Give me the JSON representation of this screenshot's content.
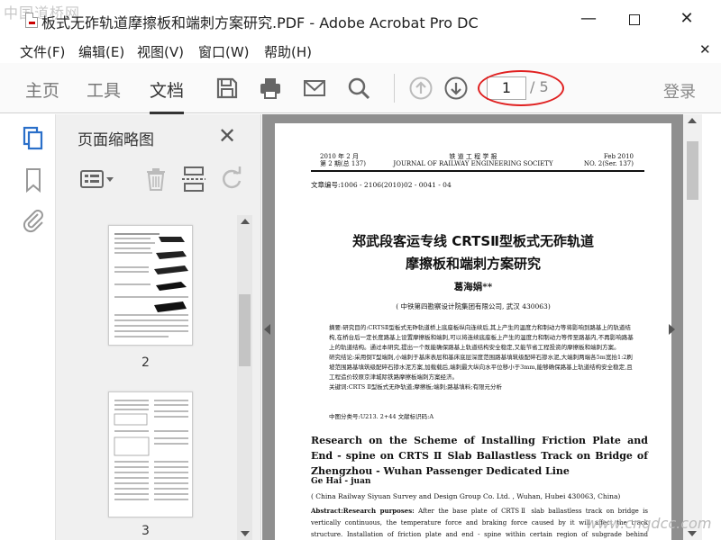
{
  "watermark": {
    "site_logo": "中国道桥网",
    "url": "www.cnqdcc.com"
  },
  "window": {
    "title": "板式无砟轨道摩擦板和端刺方案研究.PDF - Adobe Acrobat Pro DC"
  },
  "menu": {
    "items": [
      "文件(F)",
      "编辑(E)",
      "视图(V)",
      "窗口(W)",
      "帮助(H)"
    ]
  },
  "toolbar": {
    "tabs": [
      "主页",
      "工具",
      "文档"
    ],
    "active_tab": "文档",
    "page_current": "1",
    "page_total": "/ 5",
    "login": "登录",
    "annotation_color": "#e02020"
  },
  "thumbnails": {
    "title": "页面缩略图",
    "pages": [
      {
        "label": "2"
      },
      {
        "label": "3"
      }
    ]
  },
  "document": {
    "header_left": [
      "2010 年 2 月",
      "第 2 期(总 137)"
    ],
    "header_center": [
      "铁  道  工  程  学  报",
      "JOURNAL OF RAILWAY ENGINEERING SOCIETY"
    ],
    "header_right": [
      "Feb 2010",
      "NO. 2(Ser. 137)"
    ],
    "article_no": "文章编号:1006 - 2106(2010)02 - 0041 - 04",
    "cn_title_line1": "郑武段客运专线 CRTSⅡ型板式无砟轨道",
    "cn_title_line2": "摩擦板和端刺方案研究",
    "cn_author": "葛海娟**",
    "cn_affiliation": "( 中铁第四勘察设计院集团有限公司,  武汉  430063)",
    "cn_abstract": "摘要:研究目的:CRTSⅡ型板式无砟轨道桥上底座板纵向连续后,其上产生的温度力和制动力等将影响到路基上的轨道结构,在桥台后一定长度路基上设置摩擦板和端刺,可以将连续底座板上产生的温度力和制动力等传至路基内,不再影响路基上的轨道结构。通过本研究,提出一个既能确保路基上轨道结构安全稳定,又能节省工程投资的摩擦板和端刺方案。",
    "cn_conclusion": "研究结论:采用倒T型端刺,小端刺于基床表层和基床底层深度范围路基填筑级配碎石掺水泥,大端刺两端各5m宽抬1:2刷坡范围路基填筑级配碎石掺水泥方案,加载载后,端刺最大纵向水平位移小于3mm,能够确保路基上轨道结构安全稳定,且工程造价较原京津城际铁路摩擦板端刺方案经济。",
    "cn_keywords": "关键词:CRTS Ⅱ型板式无砟轨道;摩擦板;端刺;路基填料;有限元分析",
    "cn_meta": "中图分类号:U213. 2+44        文献标识码:A",
    "en_title": "Research on the Scheme of Installing Friction Plate and End - spine on CRTS Ⅱ Slab Ballastless Track on Bridge of Zhengzhou - Wuhan Passenger Dedicated Line",
    "en_author": "Ge Hai - juan",
    "en_affiliation": "( China Railway Siyuan Survey and Design Group Co. Ltd. , Wuhan, Hubei 430063, China)",
    "en_abstract_label": "Abstract:Research purposes:",
    "en_abstract": " After the base plate of CRTSⅡ slab ballastless track on bridge is vertically continuous, the temperature force and braking force caused by it will affect the track structure. Installation of friction plate and end - spine within certain region of subgrade behind abutment can transfer the forces to subgrade, and they will not affect track structure. The purpose of this research is to seek a scheme of installation of the friction plate and end - spine"
  }
}
